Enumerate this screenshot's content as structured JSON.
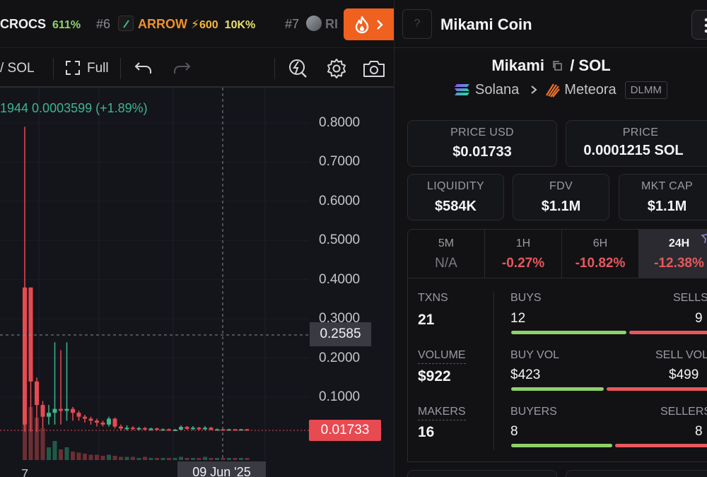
{
  "ticker": {
    "items": [
      {
        "rank": "",
        "symbol": "CROCS",
        "change": "611%"
      },
      {
        "rank": "#6",
        "symbol": "ARROW",
        "boost": "600",
        "mcap": "10K%"
      },
      {
        "rank": "#7",
        "symbol": "RI"
      }
    ]
  },
  "toolbar": {
    "pair_suffix": "/ SOL",
    "full_label": "Full"
  },
  "chart": {
    "ohlc_line": "1944  0.0003599 (+1.89%)",
    "crosshair_price": "0.2585",
    "last_price": "0.01733",
    "x_hover_label": "09 Jun '25",
    "x_left_label": "7",
    "colors": {
      "up": "#3fb58f",
      "down": "#e84a52"
    }
  },
  "chart_data": {
    "type": "candlestick",
    "y_axis": {
      "ticks": [
        "0.8000",
        "0.7000",
        "0.6000",
        "0.5000",
        "0.4000",
        "0.3000",
        "0.2000",
        "0.1000"
      ],
      "range": [
        0,
        0.85
      ]
    },
    "candles": [
      {
        "o": 0.03,
        "h": 0.79,
        "l": 0.0,
        "c": 0.38,
        "up": false
      },
      {
        "o": 0.38,
        "h": 0.38,
        "l": 0.0,
        "c": 0.14,
        "up": false
      },
      {
        "o": 0.14,
        "h": 0.15,
        "l": 0.0,
        "c": 0.08,
        "up": false
      },
      {
        "o": 0.08,
        "h": 0.09,
        "l": 0.02,
        "c": 0.05,
        "up": false
      },
      {
        "o": 0.05,
        "h": 0.08,
        "l": 0.03,
        "c": 0.06,
        "up": true
      },
      {
        "o": 0.06,
        "h": 0.24,
        "l": 0.03,
        "c": 0.07,
        "up": true
      },
      {
        "o": 0.07,
        "h": 0.22,
        "l": 0.03,
        "c": 0.065,
        "up": false
      },
      {
        "o": 0.065,
        "h": 0.24,
        "l": 0.04,
        "c": 0.07,
        "up": true
      },
      {
        "o": 0.07,
        "h": 0.075,
        "l": 0.04,
        "c": 0.06,
        "up": false
      },
      {
        "o": 0.06,
        "h": 0.065,
        "l": 0.04,
        "c": 0.05,
        "up": false
      },
      {
        "o": 0.05,
        "h": 0.055,
        "l": 0.035,
        "c": 0.045,
        "up": false
      },
      {
        "o": 0.045,
        "h": 0.05,
        "l": 0.03,
        "c": 0.04,
        "up": false
      },
      {
        "o": 0.04,
        "h": 0.045,
        "l": 0.025,
        "c": 0.035,
        "up": false
      },
      {
        "o": 0.035,
        "h": 0.04,
        "l": 0.025,
        "c": 0.03,
        "up": false
      },
      {
        "o": 0.03,
        "h": 0.05,
        "l": 0.025,
        "c": 0.045,
        "up": true
      },
      {
        "o": 0.045,
        "h": 0.048,
        "l": 0.02,
        "c": 0.025,
        "up": false
      },
      {
        "o": 0.025,
        "h": 0.03,
        "l": 0.015,
        "c": 0.02,
        "up": false
      },
      {
        "o": 0.02,
        "h": 0.028,
        "l": 0.015,
        "c": 0.022,
        "up": true
      },
      {
        "o": 0.022,
        "h": 0.026,
        "l": 0.016,
        "c": 0.019,
        "up": false
      },
      {
        "o": 0.019,
        "h": 0.024,
        "l": 0.015,
        "c": 0.021,
        "up": true
      },
      {
        "o": 0.021,
        "h": 0.024,
        "l": 0.015,
        "c": 0.018,
        "up": false
      },
      {
        "o": 0.018,
        "h": 0.022,
        "l": 0.014,
        "c": 0.02,
        "up": true
      },
      {
        "o": 0.02,
        "h": 0.022,
        "l": 0.015,
        "c": 0.017,
        "up": false
      },
      {
        "o": 0.017,
        "h": 0.02,
        "l": 0.014,
        "c": 0.018,
        "up": true
      },
      {
        "o": 0.018,
        "h": 0.02,
        "l": 0.014,
        "c": 0.016,
        "up": false
      },
      {
        "o": 0.016,
        "h": 0.019,
        "l": 0.014,
        "c": 0.017,
        "up": true
      },
      {
        "o": 0.017,
        "h": 0.028,
        "l": 0.015,
        "c": 0.024,
        "up": true
      },
      {
        "o": 0.024,
        "h": 0.026,
        "l": 0.017,
        "c": 0.019,
        "up": false
      },
      {
        "o": 0.019,
        "h": 0.026,
        "l": 0.016,
        "c": 0.022,
        "up": true
      },
      {
        "o": 0.022,
        "h": 0.024,
        "l": 0.016,
        "c": 0.018,
        "up": false
      },
      {
        "o": 0.018,
        "h": 0.026,
        "l": 0.016,
        "c": 0.022,
        "up": true
      },
      {
        "o": 0.022,
        "h": 0.024,
        "l": 0.015,
        "c": 0.017,
        "up": false
      },
      {
        "o": 0.017,
        "h": 0.02,
        "l": 0.015,
        "c": 0.018,
        "up": true
      },
      {
        "o": 0.018,
        "h": 0.019,
        "l": 0.015,
        "c": 0.016,
        "up": false
      },
      {
        "o": 0.016,
        "h": 0.019,
        "l": 0.015,
        "c": 0.018,
        "up": true
      },
      {
        "o": 0.018,
        "h": 0.019,
        "l": 0.015,
        "c": 0.017,
        "up": false
      },
      {
        "o": 0.017,
        "h": 0.019,
        "l": 0.015,
        "c": 0.018,
        "up": true
      },
      {
        "o": 0.018,
        "h": 0.019,
        "l": 0.015,
        "c": 0.0173,
        "up": false
      }
    ],
    "volumes": [
      0.55,
      0.5,
      0.4,
      0.3,
      0.12,
      0.18,
      0.1,
      0.12,
      0.08,
      0.07,
      0.06,
      0.05,
      0.05,
      0.04,
      0.05,
      0.04,
      0.03,
      0.03,
      0.03,
      0.02,
      0.03,
      0.02,
      0.02,
      0.02,
      0.02,
      0.02,
      0.03,
      0.02,
      0.02,
      0.02,
      0.03,
      0.02,
      0.02,
      0.02,
      0.02,
      0.02,
      0.02,
      0.02
    ]
  },
  "panel": {
    "title": "Mikami Coin",
    "logo_placeholder": "?",
    "pair_base": "Mikami",
    "pair_quote": "/  SOL",
    "chain": "Solana",
    "dex": "Meteora",
    "dex_type": "DLMM",
    "metrics": {
      "price_usd": {
        "label": "PRICE USD",
        "value": "$0.01733"
      },
      "price": {
        "label": "PRICE",
        "value": "0.0001215 SOL"
      },
      "liquidity": {
        "label": "LIQUIDITY",
        "value": "$584K"
      },
      "fdv": {
        "label": "FDV",
        "value": "$1.1M"
      },
      "mkt_cap": {
        "label": "MKT CAP",
        "value": "$1.1M"
      }
    },
    "timeframes": [
      {
        "label": "5M",
        "value": "N/A"
      },
      {
        "label": "1H",
        "value": "-0.27%"
      },
      {
        "label": "6H",
        "value": "-10.82%"
      },
      {
        "label": "24H",
        "value": "-12.38%"
      }
    ],
    "stats": {
      "txns": {
        "label": "TXNS",
        "value": "21"
      },
      "buys": {
        "label": "BUYS",
        "value": "12",
        "fraction": 0.571
      },
      "sells": {
        "label": "SELLS",
        "value": "9"
      },
      "volume": {
        "label": "VOLUME",
        "value": "$922"
      },
      "buy_vol": {
        "label": "BUY VOL",
        "value": "$423",
        "fraction": 0.459
      },
      "sell_vol": {
        "label": "SELL VOL",
        "value": "$499"
      },
      "makers": {
        "label": "MAKERS",
        "value": "16"
      },
      "buyers": {
        "label": "BUYERS",
        "value": "8",
        "fraction": 0.5
      },
      "sellers": {
        "label": "SELLERS",
        "value": "8"
      }
    },
    "colors": {
      "positive": "#8fd16a",
      "negative": "#e8585c"
    }
  }
}
